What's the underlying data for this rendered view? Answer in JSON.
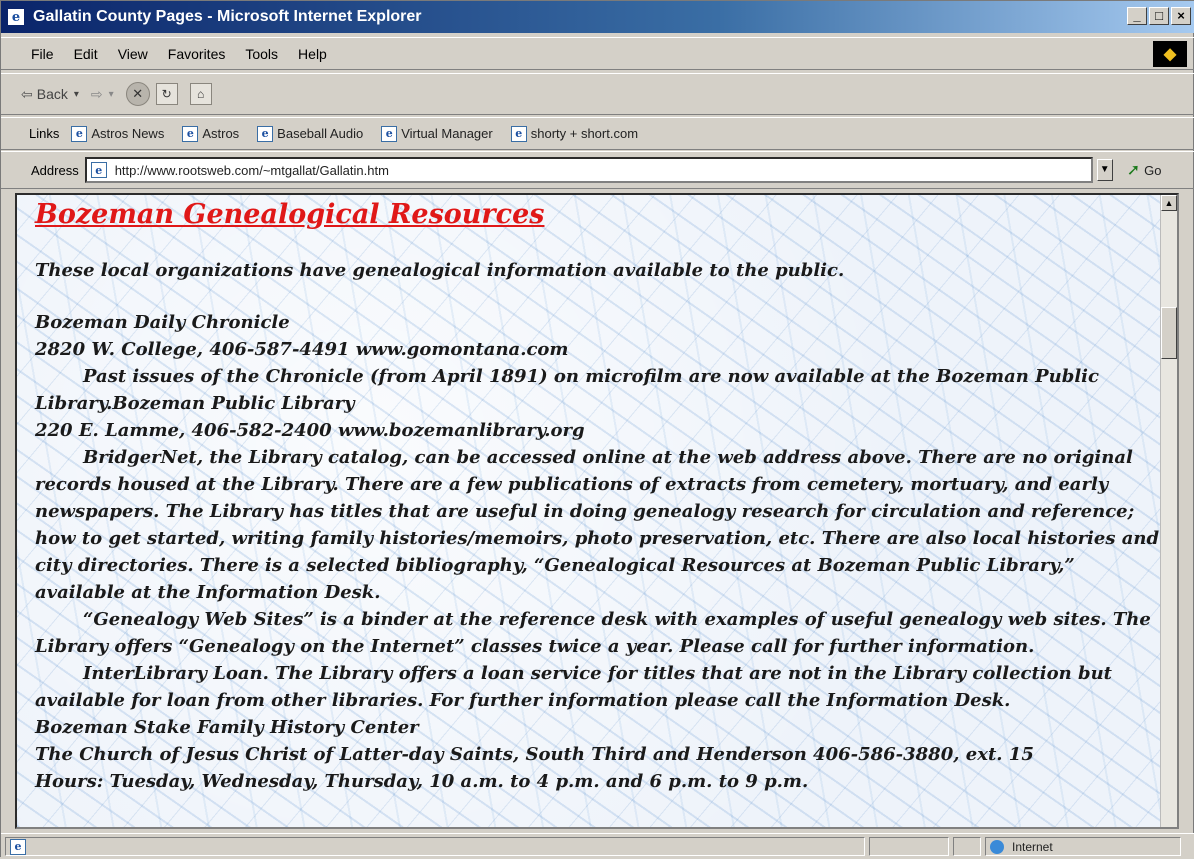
{
  "window": {
    "title": "Gallatin County Pages - Microsoft Internet Explorer",
    "buttons": [
      "_",
      "□",
      "×"
    ]
  },
  "menu": [
    "File",
    "Edit",
    "View",
    "Favorites",
    "Tools",
    "Help"
  ],
  "toolbar": {
    "back_label": "Back",
    "back_arrow": "⇦",
    "forward_arrow": "⇨",
    "back_drop": "▾",
    "forward_drop": "▾"
  },
  "links": {
    "label": "Links",
    "items": [
      "Astros News",
      "Astros",
      "Baseball Audio",
      "Virtual Manager",
      "shorty + short.com"
    ]
  },
  "address": {
    "label": "Address",
    "url": "http://www.rootsweb.com/~mtgallat/Gallatin.htm",
    "go_label": "Go"
  },
  "page": {
    "heading": "Bozeman Genealogical Resources",
    "intro": "These local organizations have genealogical information available to the public.",
    "lines": [
      {
        "text": "Bozeman Daily Chronicle",
        "indent": false
      },
      {
        "text": "2820 W. College, 406-587-4491    www.gomontana.com",
        "indent": false
      },
      {
        "text": "Past issues of the Chronicle (from April 1891) on microfilm are now available at the Bozeman Public Library.Bozeman Public Library",
        "indent": true
      },
      {
        "text": "220 E. Lamme, 406-582-2400    www.bozemanlibrary.org",
        "indent": false
      },
      {
        "text": "BridgerNet, the Library catalog, can be accessed online at the web address above.  There are no original records housed at the Library.  There are a few publications of extracts from cemetery, mortuary, and early newspapers.  The Library has titles that are useful in doing genealogy research for circulation and reference; how to get started, writing family histories/memoirs, photo preservation, etc.  There are also local histories and city directories.  There is a selected bibliography, “Genealogical Resources at Bozeman Public Library,” available at the Information Desk.",
        "indent": true
      },
      {
        "text": "“Genealogy Web Sites” is a binder at the reference desk with examples of useful genealogy web sites.  The Library offers “Genealogy on the Internet” classes twice a year.  Please call for further information.",
        "indent": true
      },
      {
        "text": "InterLibrary Loan.  The Library offers a loan service for titles that are not in the Library collection but available for loan from other libraries.  For further information please call the Information Desk.",
        "indent": true
      },
      {
        "text": "Bozeman Stake Family History Center",
        "indent": false
      },
      {
        "text": "The Church of Jesus Christ of Latter-day Saints, South Third and Henderson 406-586-3880, ext. 15",
        "indent": false
      },
      {
        "text": "Hours: Tuesday, Wednesday, Thursday, 10 a.m. to 4 p.m. and 6 p.m. to 9 p.m.",
        "indent": false
      }
    ]
  },
  "status": {
    "zone": "Internet"
  },
  "colors": {
    "heading": "#e01818",
    "titlebar_start": "#0a246a",
    "chrome": "#d4d0c8"
  }
}
